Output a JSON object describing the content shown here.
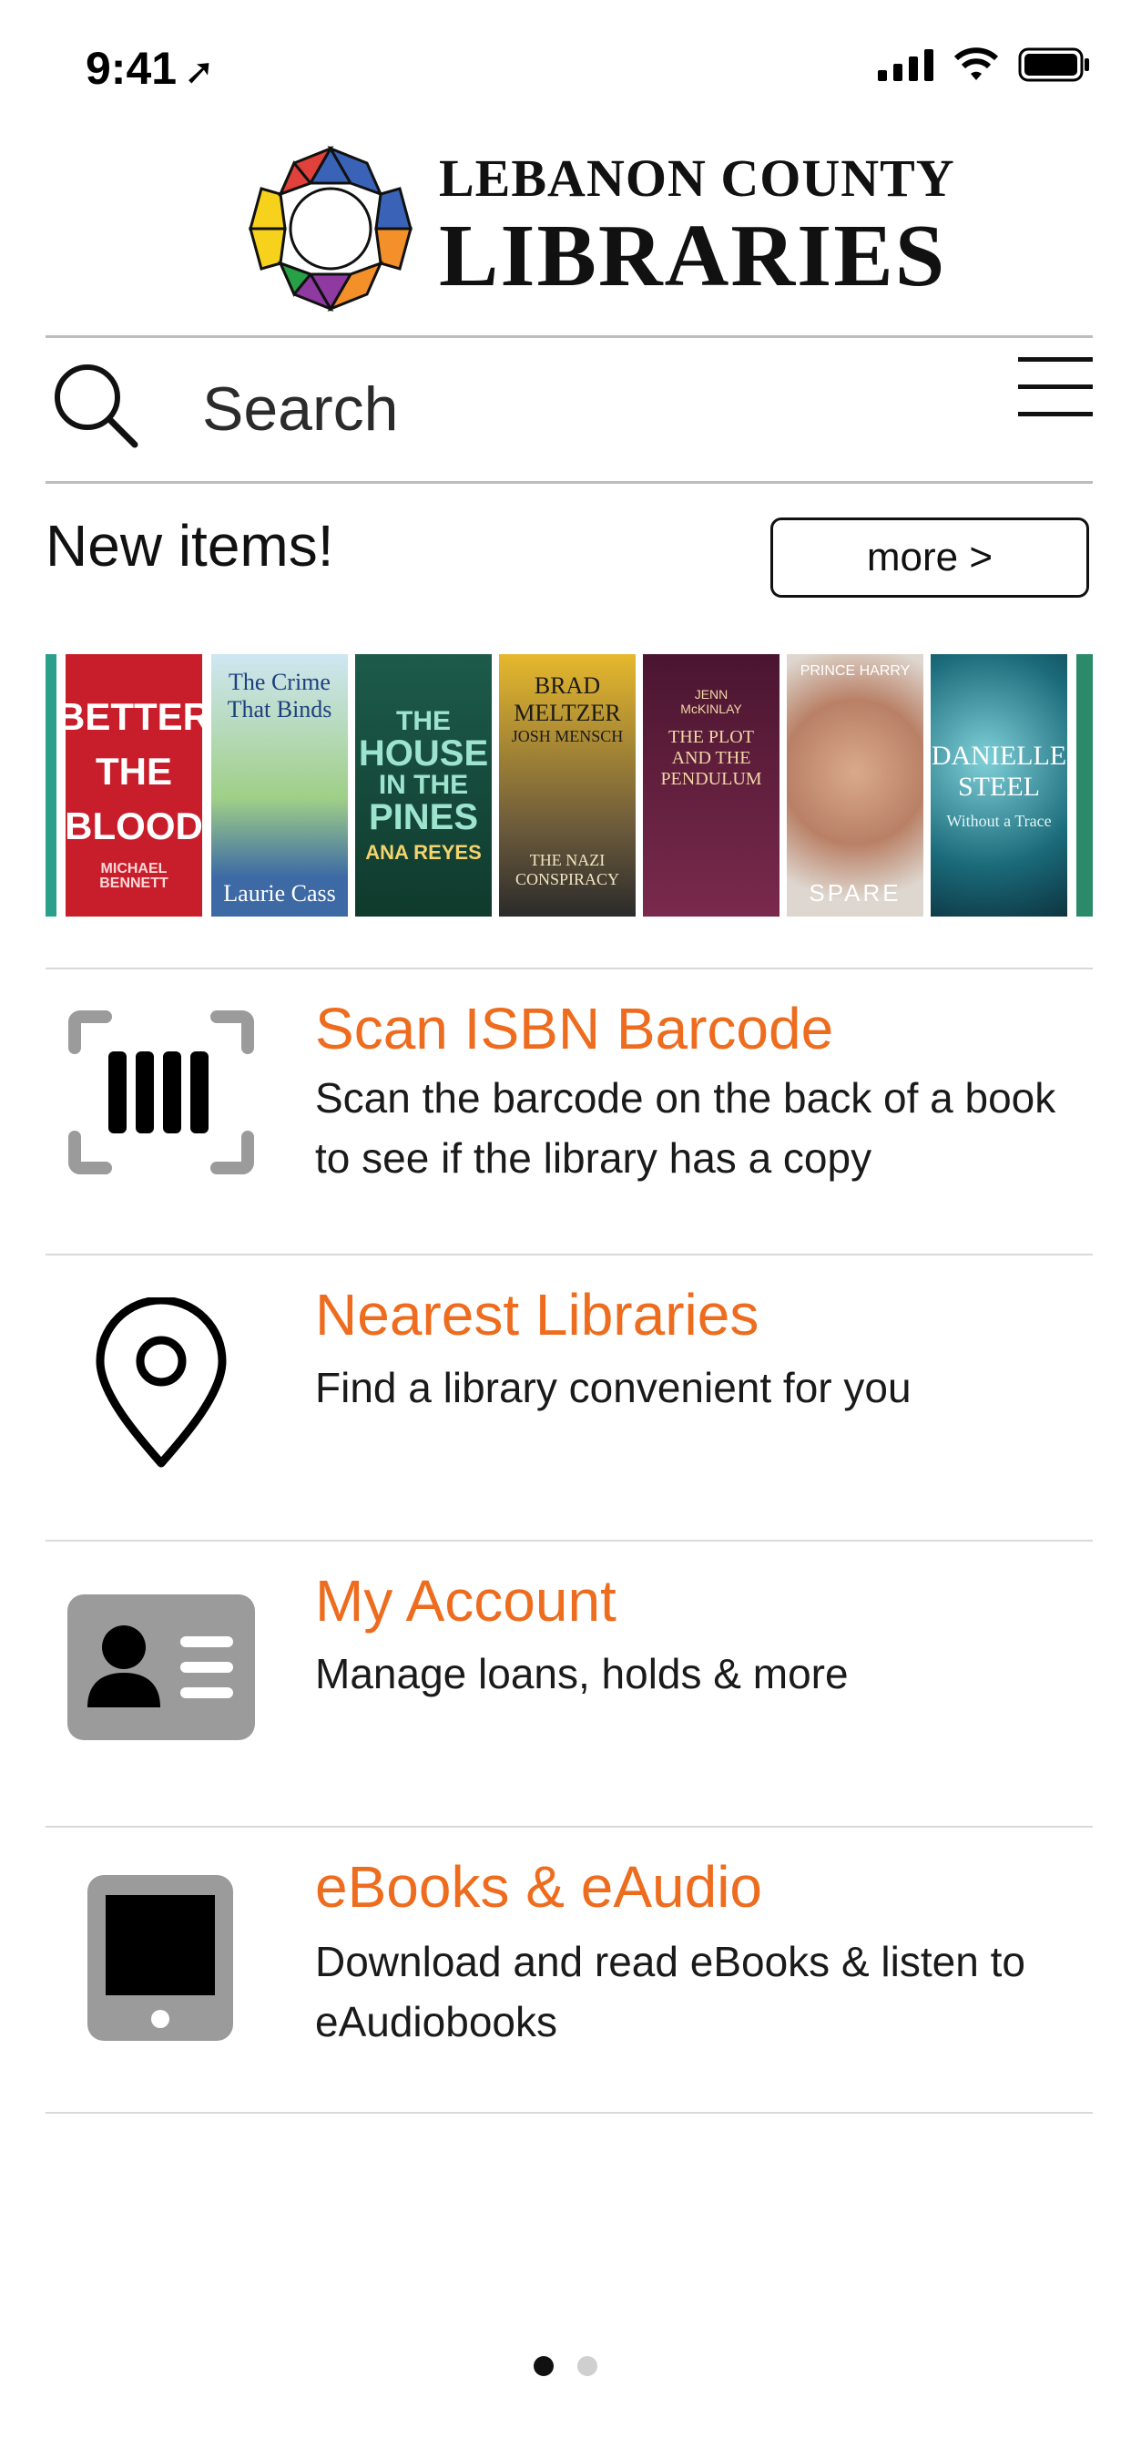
{
  "status": {
    "time": "9:41"
  },
  "logo": {
    "line1": "LEBANON COUNTY",
    "line2": "LIBRARIES"
  },
  "search": {
    "placeholder": "Search"
  },
  "new_items": {
    "title": "New items!",
    "more_label": "more >"
  },
  "covers": [
    {
      "lines": [
        "BETTER",
        "THE",
        "BLOOD"
      ],
      "author": "MICHAEL BENNETT"
    },
    {
      "lines": [
        "The Crime",
        "That Binds"
      ],
      "author": "Laurie Cass"
    },
    {
      "lines": [
        "THE",
        "HOUSE",
        "IN THE",
        "PINES"
      ],
      "author": "ANA REYES"
    },
    {
      "lines": [
        "BRAD",
        "MELTZER"
      ],
      "author": "JOSH MENSCH",
      "subtitle": "THE NAZI CONSPIRACY"
    },
    {
      "lines": [
        "JENN",
        "McKINLAY"
      ],
      "author": "THE PLOT AND THE PENDULUM"
    },
    {
      "lines": [
        "PRINCE HARRY"
      ],
      "author": "SPARE"
    },
    {
      "lines": [
        "DANIELLE",
        "STEEL"
      ],
      "author": "Without a Trace"
    }
  ],
  "menu": [
    {
      "title": "Scan ISBN Barcode",
      "desc1": "Scan the barcode on the back of a book",
      "desc2": "to see if the library has a copy",
      "icon": "barcode-scan-icon"
    },
    {
      "title": "Nearest Libraries",
      "desc1": "Find a library convenient for you",
      "desc2": "",
      "icon": "map-pin-icon"
    },
    {
      "title": "My Account",
      "desc1": "Manage loans, holds & more",
      "desc2": "",
      "icon": "id-card-icon"
    },
    {
      "title": "eBooks & eAudio",
      "desc1": "Download and read eBooks & listen to",
      "desc2": "eAudiobooks",
      "icon": "tablet-icon"
    }
  ],
  "page_indicator": {
    "pages": 2,
    "current": 1
  },
  "colors": {
    "accent": "#ee6c1e",
    "icon_gray": "#9b9b9b"
  }
}
